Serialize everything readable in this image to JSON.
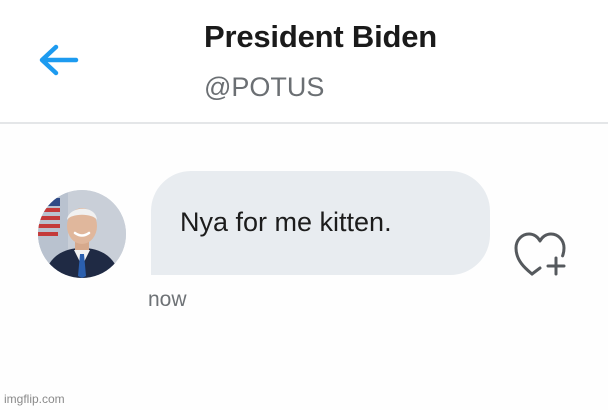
{
  "header": {
    "back_icon": "arrow-left-icon",
    "title": "President Biden",
    "handle": "@POTUS"
  },
  "conversation": {
    "messages": [
      {
        "sender_avatar": "avatar",
        "text": "Nya for me kitten.",
        "timestamp": "now",
        "reaction_icon": "heart-plus-icon"
      }
    ]
  },
  "watermark": "imgflip.com",
  "colors": {
    "accent": "#1d9bf0",
    "bubble": "#e8ecf0",
    "divider": "#e4e6e8"
  }
}
